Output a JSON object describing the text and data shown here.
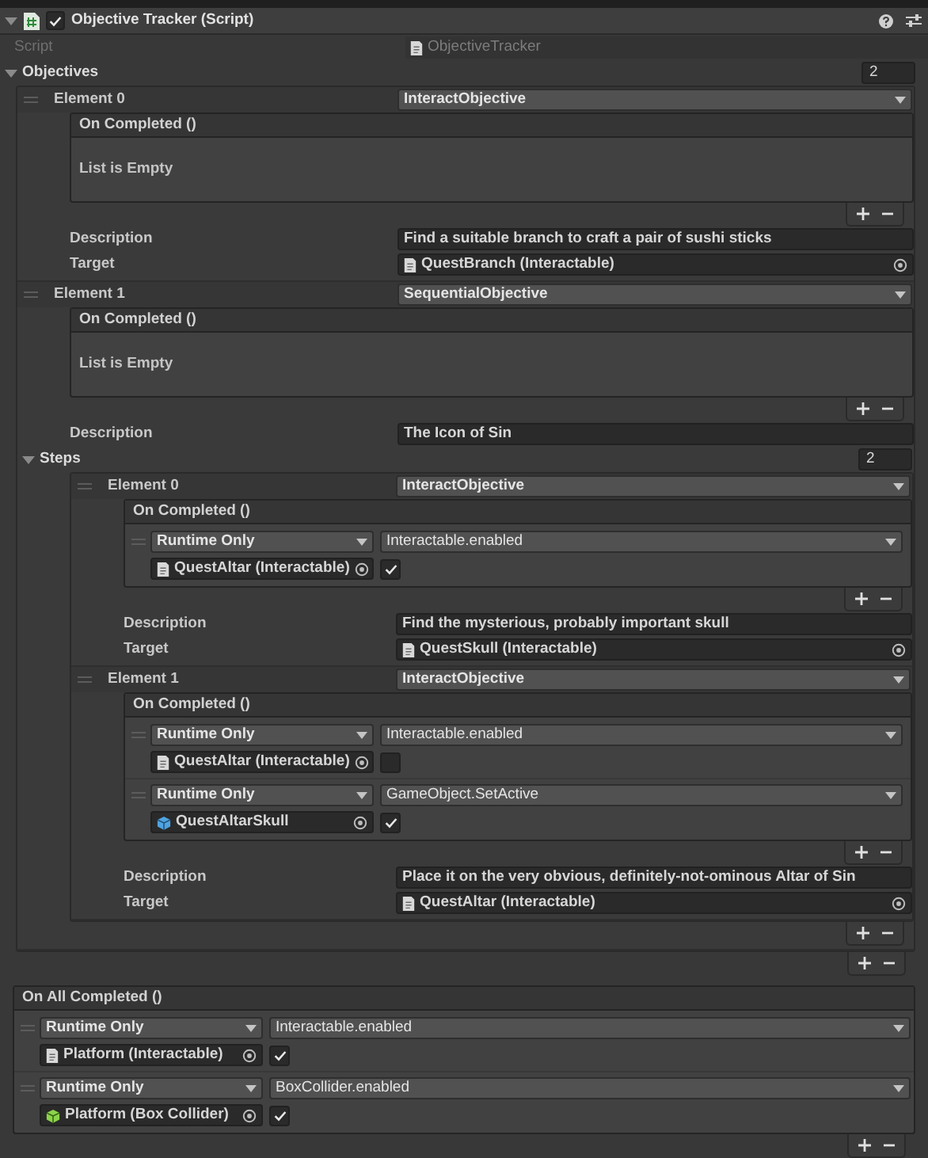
{
  "component": {
    "title": "Objective Tracker (Script)",
    "enabled": true,
    "expanded": true
  },
  "script": {
    "label": "Script",
    "value": "ObjectiveTracker"
  },
  "objectives": {
    "label": "Objectives",
    "count": "2",
    "expanded": true,
    "elements": [
      {
        "label": "Element 0",
        "type": "InteractObjective",
        "on_completed": {
          "title": "On Completed ()",
          "empty_text": "List is Empty"
        },
        "description": {
          "label": "Description",
          "value": "Find a suitable branch to craft a pair of sushi sticks"
        },
        "target": {
          "label": "Target",
          "value": "QuestBranch (Interactable)"
        }
      },
      {
        "label": "Element 1",
        "type": "SequentialObjective",
        "on_completed": {
          "title": "On Completed ()",
          "empty_text": "List is Empty"
        },
        "description": {
          "label": "Description",
          "value": "The Icon of Sin"
        },
        "steps": {
          "label": "Steps",
          "count": "2",
          "expanded": true,
          "elements": [
            {
              "label": "Element 0",
              "type": "InteractObjective",
              "on_completed": {
                "title": "On Completed ()",
                "calls": [
                  {
                    "mode": "Runtime Only",
                    "function": "Interactable.enabled",
                    "target": "QuestAltar (Interactable)",
                    "kind": "script",
                    "checked": true
                  }
                ]
              },
              "description": {
                "label": "Description",
                "value": "Find the mysterious, probably important skull"
              },
              "target": {
                "label": "Target",
                "value": "QuestSkull (Interactable)"
              }
            },
            {
              "label": "Element 1",
              "type": "InteractObjective",
              "on_completed": {
                "title": "On Completed ()",
                "calls": [
                  {
                    "mode": "Runtime Only",
                    "function": "Interactable.enabled",
                    "target": "QuestAltar (Interactable)",
                    "kind": "script",
                    "checked": false
                  },
                  {
                    "mode": "Runtime Only",
                    "function": "GameObject.SetActive",
                    "target": "QuestAltarSkull",
                    "kind": "gameobject",
                    "checked": true
                  }
                ]
              },
              "description": {
                "label": "Description",
                "value": "Place it on the very obvious, definitely-not-ominous Altar of Sin"
              },
              "target": {
                "label": "Target",
                "value": "QuestAltar (Interactable)"
              }
            }
          ]
        }
      }
    ]
  },
  "on_all_completed": {
    "title": "On All Completed ()",
    "calls": [
      {
        "mode": "Runtime Only",
        "function": "Interactable.enabled",
        "target": "Platform (Interactable)",
        "kind": "script",
        "checked": true
      },
      {
        "mode": "Runtime Only",
        "function": "BoxCollider.enabled",
        "target": "Platform (Box Collider)",
        "kind": "collider",
        "checked": true
      }
    ]
  }
}
